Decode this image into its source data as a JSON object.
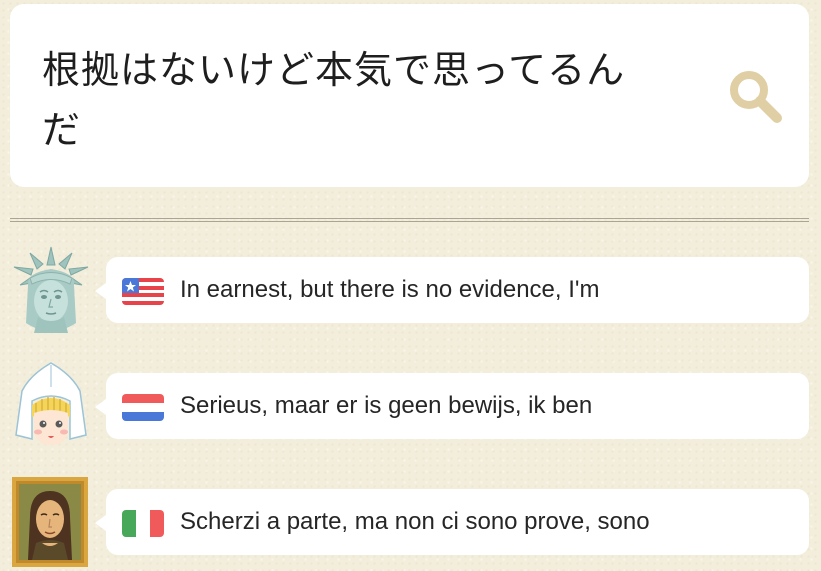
{
  "query": {
    "text": "根拠はないけど本気で思ってるんだ",
    "search_icon": "magnifier-icon"
  },
  "colors": {
    "background": "#f3eedc",
    "card": "#ffffff",
    "icon_tan": "#e0cfa4",
    "text": "#262626"
  },
  "translations": [
    {
      "language_flag": "us-flag-icon",
      "avatar": "statue-of-liberty-avatar",
      "text": "In earnest, but there is no evidence, I'm"
    },
    {
      "language_flag": "netherlands-flag-icon",
      "avatar": "dutch-girl-avatar",
      "text": "Serieus, maar er is geen bewijs, ik ben"
    },
    {
      "language_flag": "italy-flag-icon",
      "avatar": "mona-lisa-avatar",
      "text": "Scherzi a parte, ma non ci sono prove, sono"
    }
  ]
}
